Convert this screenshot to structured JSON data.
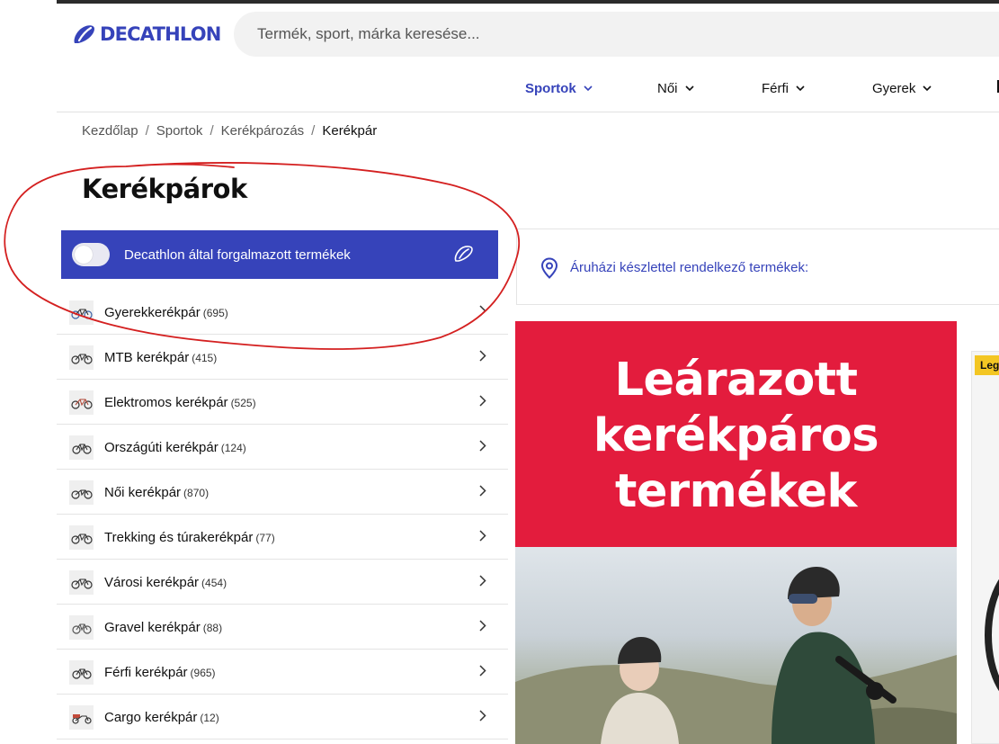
{
  "header": {
    "brand": "DECATHLON",
    "search_placeholder": "Termék, sport, márka keresése...",
    "nav": [
      {
        "label": "Sportok",
        "active": true
      },
      {
        "label": "Női",
        "active": false
      },
      {
        "label": "Férfi",
        "active": false
      },
      {
        "label": "Gyerek",
        "active": false
      }
    ]
  },
  "breadcrumb": [
    "Kezdőlap",
    "Sportok",
    "Kerékpározás",
    "Kerékpár"
  ],
  "page_title": "Kerékpárok",
  "toggle": {
    "label": "Decathlon által forgalmazott termékek",
    "on": false
  },
  "categories": [
    {
      "name": "Gyerekkerékpár",
      "count": "(695)"
    },
    {
      "name": "MTB kerékpár",
      "count": "(415)"
    },
    {
      "name": "Elektromos kerékpár",
      "count": "(525)"
    },
    {
      "name": "Országúti kerékpár",
      "count": "(124)"
    },
    {
      "name": "Női kerékpár",
      "count": "(870)"
    },
    {
      "name": "Trekking és túrakerékpár",
      "count": "(77)"
    },
    {
      "name": "Városi kerékpár",
      "count": "(454)"
    },
    {
      "name": "Gravel kerékpár",
      "count": "(88)"
    },
    {
      "name": "Férfi kerékpár",
      "count": "(965)"
    },
    {
      "name": "Cargo kerékpár",
      "count": "(12)"
    }
  ],
  "store_filter": {
    "label": "Áruházi készlettel rendelkező termékek:"
  },
  "promo": {
    "lines": [
      "Leárazott",
      "kerékpáros",
      "termékek"
    ]
  },
  "side_card": {
    "badge": "Leg"
  },
  "colors": {
    "brand_blue": "#3643ba",
    "promo_red": "#e31c3d",
    "badge_yellow": "#f3c623",
    "annotation_red": "#d42020"
  }
}
